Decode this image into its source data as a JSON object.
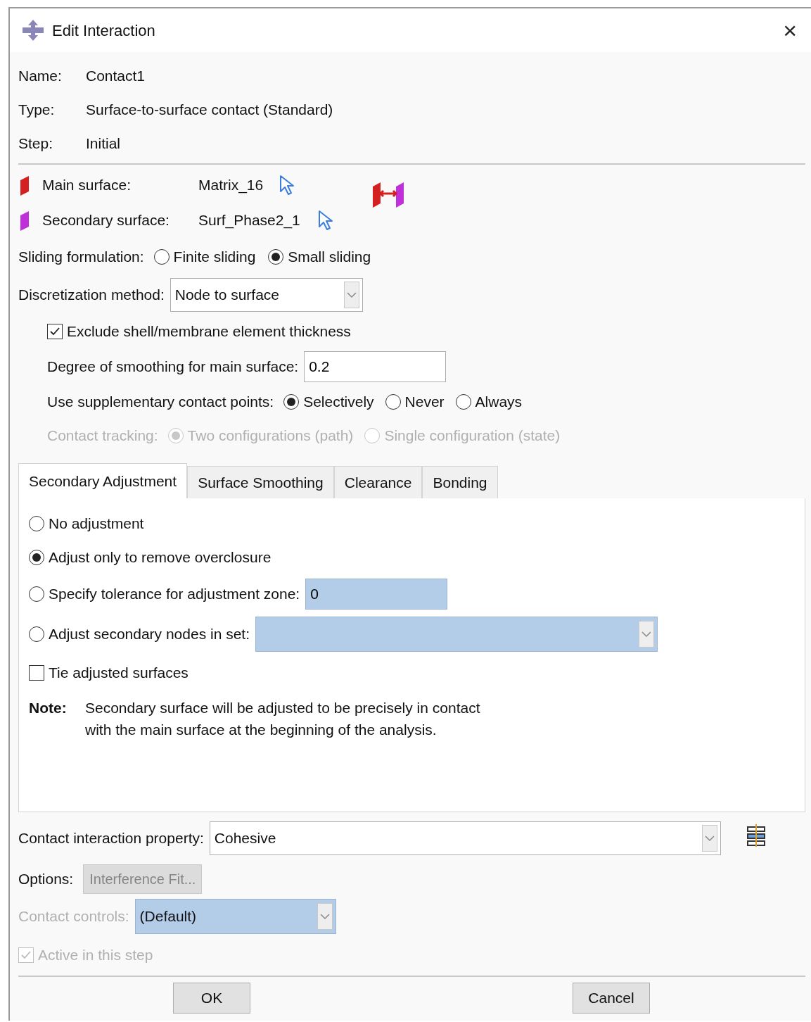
{
  "window": {
    "title": "Edit Interaction",
    "close": "×"
  },
  "info": [
    {
      "label": "Name:",
      "value": "Contact1"
    },
    {
      "label": "Type:",
      "value": "Surface-to-surface contact (Standard)"
    },
    {
      "label": "Step:",
      "value": "Initial"
    }
  ],
  "surfaces": [
    {
      "label": "Main surface:",
      "value": "Matrix_16",
      "color": "#d42020"
    },
    {
      "label": "Secondary surface:",
      "value": "Surf_Phase2_1",
      "color": "#c030d8"
    }
  ],
  "sliding": {
    "label": "Sliding formulation:",
    "options": [
      {
        "label": "Finite sliding",
        "selected": false
      },
      {
        "label": "Small sliding",
        "selected": true
      }
    ]
  },
  "discretization": {
    "label": "Discretization method:",
    "value": "Node to surface"
  },
  "exclude_thickness": {
    "label": "Exclude shell/membrane element thickness",
    "checked": true
  },
  "smoothing": {
    "label": "Degree of smoothing for main surface:",
    "value": "0.2"
  },
  "supplementary": {
    "label": "Use supplementary contact points:",
    "options": [
      {
        "label": "Selectively",
        "selected": true
      },
      {
        "label": "Never",
        "selected": false
      },
      {
        "label": "Always",
        "selected": false
      }
    ]
  },
  "contact_tracking": {
    "label": "Contact tracking:",
    "disabled": true,
    "options": [
      {
        "label": "Two configurations (path)",
        "selected": true
      },
      {
        "label": "Single configuration (state)",
        "selected": false
      }
    ]
  },
  "tabs": [
    {
      "label": "Secondary Adjustment",
      "selected": true
    },
    {
      "label": "Surface Smoothing",
      "selected": false
    },
    {
      "label": "Clearance",
      "selected": false
    },
    {
      "label": "Bonding",
      "selected": false
    }
  ],
  "adjustment": [
    {
      "kind": "radio",
      "label": "No adjustment",
      "selected": false
    },
    {
      "kind": "radio",
      "label": "Adjust only to remove overclosure",
      "selected": true
    },
    {
      "kind": "field",
      "label": "Specify tolerance for adjustment zone:",
      "selected": false,
      "value": "0"
    },
    {
      "kind": "select",
      "label": "Adjust secondary nodes in set:",
      "selected": false
    }
  ],
  "tie": {
    "label": "Tie adjusted surfaces",
    "checked": false
  },
  "note": {
    "label": "Note:",
    "lines": [
      "Secondary surface will be adjusted to be precisely in contact",
      "with the main surface at the beginning of the analysis."
    ]
  },
  "property": {
    "label": "Contact interaction property:",
    "value": "Cohesive"
  },
  "options": {
    "label": "Options:",
    "button": "Interference Fit...",
    "disabled": true
  },
  "controls": {
    "label": "Contact controls:",
    "value": "(Default)",
    "disabled": true
  },
  "active": {
    "label": "Active in this step",
    "checked": true,
    "disabled": true
  },
  "buttons": [
    "OK",
    "Cancel"
  ]
}
